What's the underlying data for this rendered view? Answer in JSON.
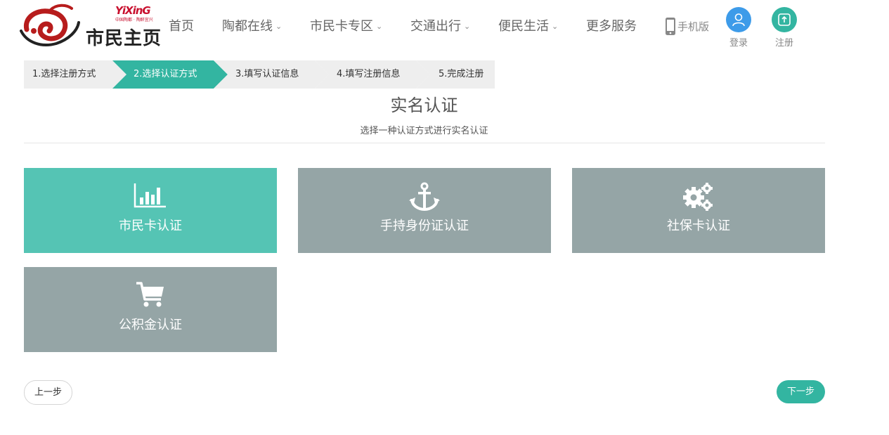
{
  "header": {
    "logo_text": "市民主页",
    "logo_brand": "YiXinG",
    "logo_tagline": "中国陶都 · 陶醉宜兴",
    "nav": [
      {
        "label": "首页",
        "dropdown": false
      },
      {
        "label": "陶都在线",
        "dropdown": true
      },
      {
        "label": "市民卡专区",
        "dropdown": true
      },
      {
        "label": "交通出行",
        "dropdown": true
      },
      {
        "label": "便民生活",
        "dropdown": true
      },
      {
        "label": "更多服务",
        "dropdown": false
      }
    ],
    "mobile_label": "手机版",
    "login_label": "登录",
    "register_label": "注册"
  },
  "steps": [
    {
      "label": "1.选择注册方式",
      "active": false
    },
    {
      "label": "2.选择认证方式",
      "active": true
    },
    {
      "label": "3.填写认证信息",
      "active": false
    },
    {
      "label": "4.填写注册信息",
      "active": false
    },
    {
      "label": "5.完成注册",
      "active": false
    }
  ],
  "page": {
    "title": "实名认证",
    "subtitle": "选择一种认证方式进行实名认证"
  },
  "cards": [
    {
      "label": "市民卡认证",
      "icon": "bar-chart-icon",
      "selected": true
    },
    {
      "label": "手持身份证认证",
      "icon": "anchor-icon",
      "selected": false
    },
    {
      "label": "社保卡认证",
      "icon": "gears-icon",
      "selected": false
    },
    {
      "label": "公积金认证",
      "icon": "cart-icon",
      "selected": false
    }
  ],
  "buttons": {
    "prev": "上一步",
    "next": "下一步"
  },
  "colors": {
    "accent": "#33b5a1",
    "card_selected": "#55c4b4",
    "card_default": "#95a5a6",
    "user_icon": "#3d9be9",
    "register_icon": "#33b5a1"
  }
}
